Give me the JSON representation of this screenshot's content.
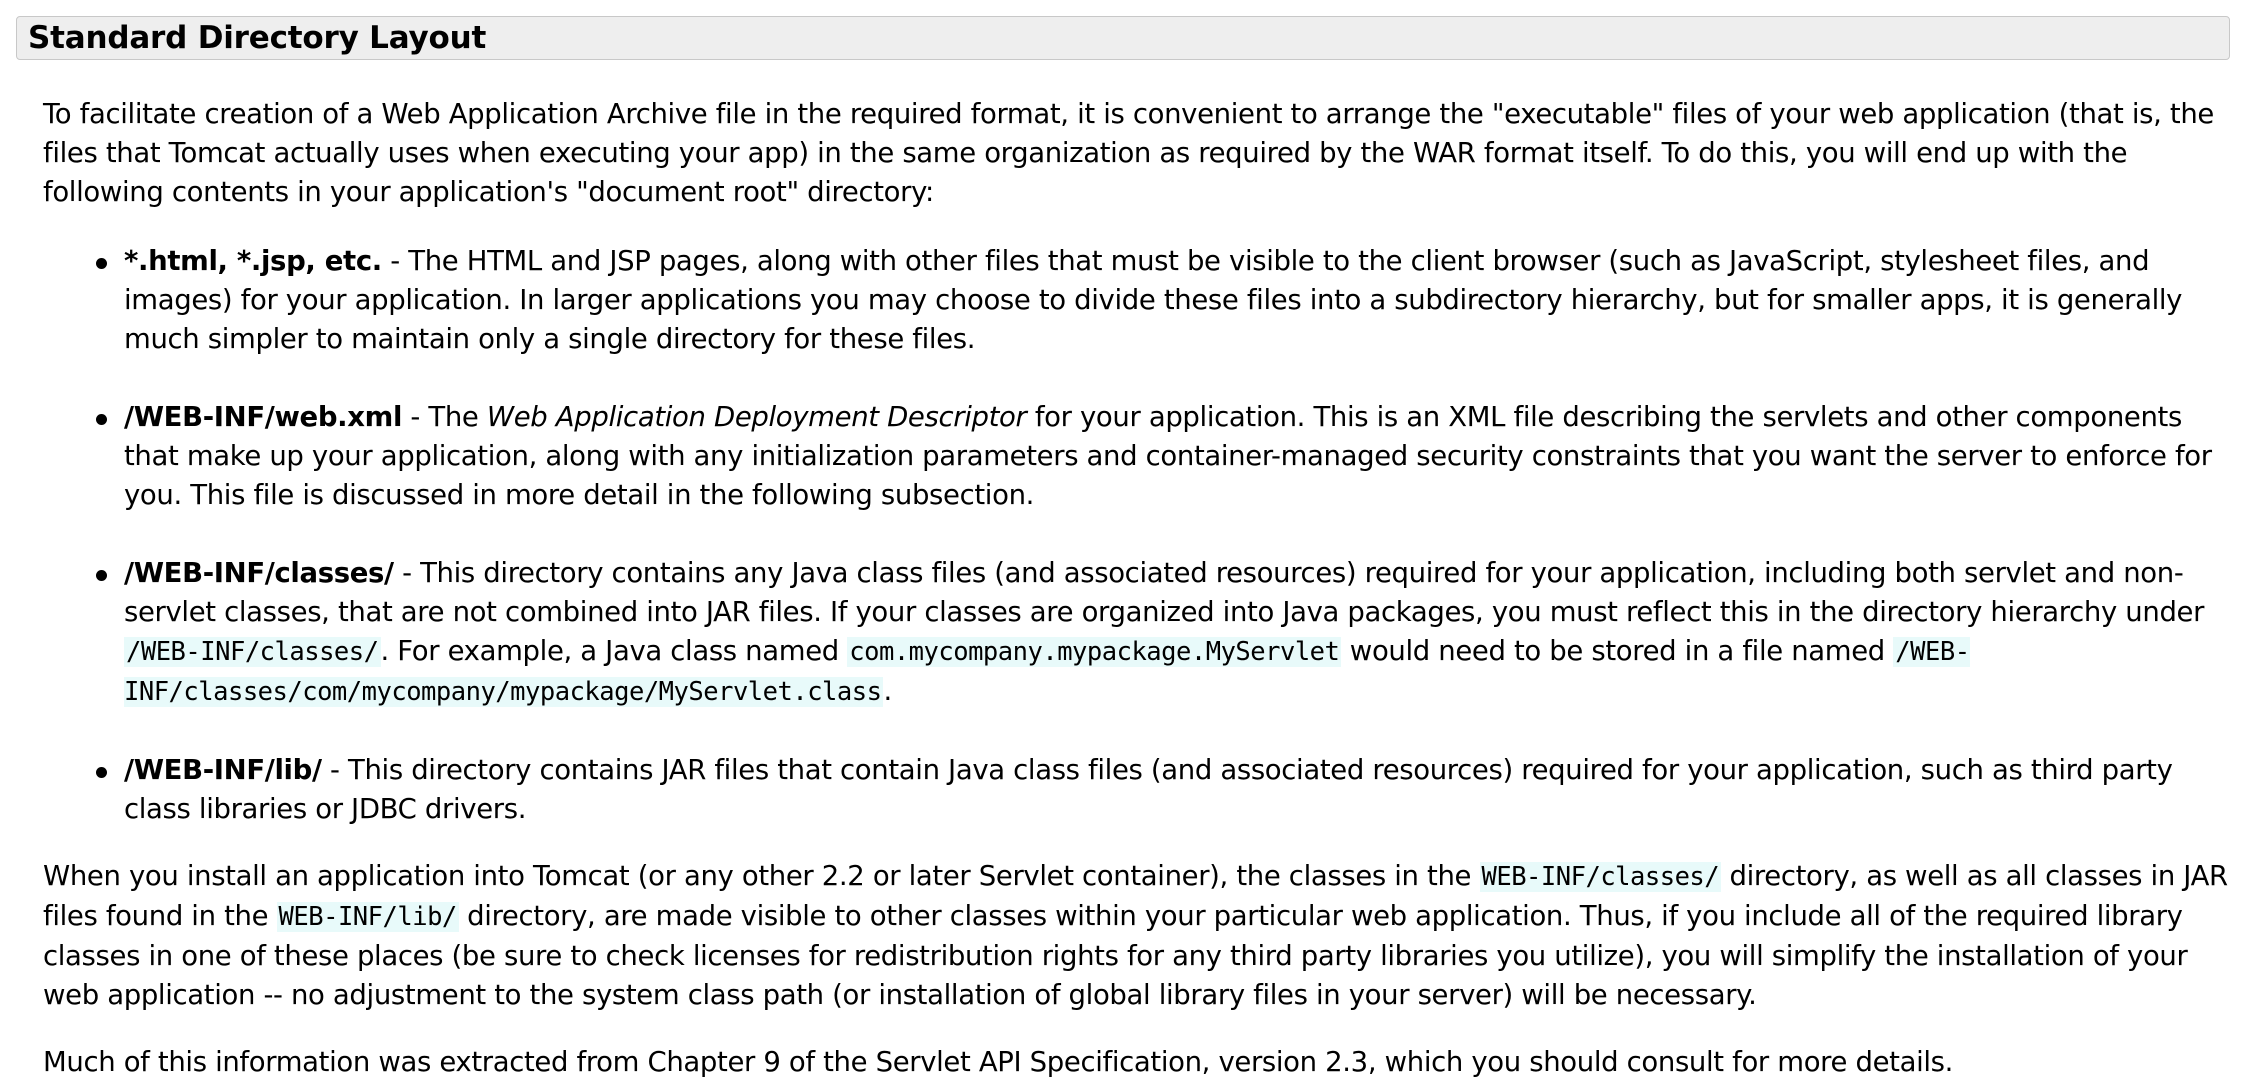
{
  "section": {
    "title": "Standard Directory Layout"
  },
  "intro": "To facilitate creation of a Web Application Archive file in the required format, it is convenient to arrange the \"executable\" files of your web application (that is, the files that Tomcat actually uses when executing your app) in the same organization as required by the WAR format itself. To do this, you will end up with the following contents in your application's \"document root\" directory:",
  "items": [
    {
      "term": "*.html, *.jsp, etc.",
      "desc": " - The HTML and JSP pages, along with other files that must be visible to the client browser (such as JavaScript, stylesheet files, and images) for your application. In larger applications you may choose to divide these files into a subdirectory hierarchy, but for smaller apps, it is generally much simpler to maintain only a single directory for these files."
    },
    {
      "term": "/WEB-INF/web.xml",
      "desc_a": " - The ",
      "emph": "Web Application Deployment Descriptor",
      "desc_b": " for your application. This is an XML file describing the servlets and other components that make up your application, along with any initialization parameters and container-managed security constraints that you want the server to enforce for you. This file is discussed in more detail in the following subsection."
    },
    {
      "term": "/WEB-INF/classes/",
      "desc_a": " - This directory contains any Java class files (and associated resources) required for your application, including both servlet and non-servlet classes, that are not combined into JAR files. If your classes are organized into Java packages, you must reflect this in the directory hierarchy under ",
      "code_a": "/WEB-INF/classes/",
      "desc_b": ". For example, a Java class named ",
      "code_b": "com.mycompany.mypackage.MyServlet",
      "desc_c": " would need to be stored in a file named ",
      "code_c": "/WEB-INF/classes/com/mycompany/mypackage/MyServlet.class",
      "desc_d": "."
    },
    {
      "term": "/WEB-INF/lib/",
      "desc": " - This directory contains JAR files that contain Java class files (and associated resources) required for your application, such as third party class libraries or JDBC drivers."
    }
  ],
  "para1": {
    "t1": "When you install an application into Tomcat (or any other 2.2 or later Servlet container), the classes in the ",
    "code1": "WEB-INF/classes/",
    "t2": " directory, as well as all classes in JAR files found in the ",
    "code2": "WEB-INF/lib/",
    "t3": " directory, are made visible to other classes within your particular web application. Thus, if you include all of the required library classes in one of these places (be sure to check licenses for redistribution rights for any third party libraries you utilize), you will simplify the installation of your web application -- no adjustment to the system class path (or installation of global library files in your server) will be necessary."
  },
  "para2": "Much of this information was extracted from Chapter 9 of the Servlet API Specification, version 2.3, which you should consult for more details."
}
